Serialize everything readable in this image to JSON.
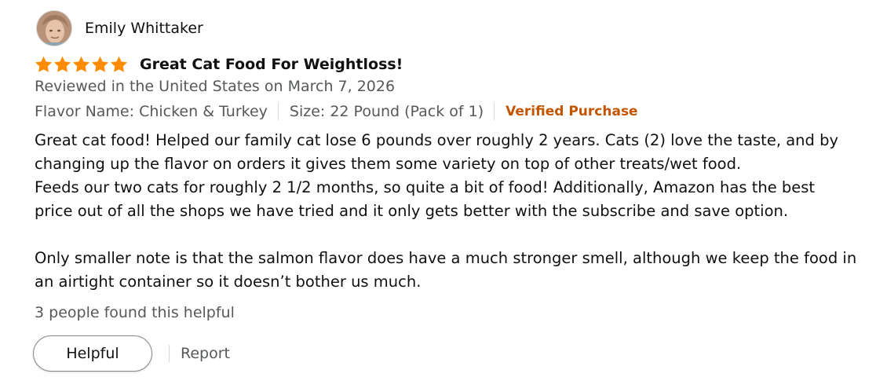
{
  "reviewer": {
    "name": "Emily Whittaker",
    "avatar_icon": "profile-photo"
  },
  "rating": {
    "stars": 5,
    "max": 5,
    "star_color": "#ff8c00"
  },
  "review": {
    "title": "Great Cat Food For Weightloss!",
    "reviewed_line": "Reviewed in the United States on March 7, 2026",
    "flavor": "Flavor Name: Chicken & Turkey",
    "size": "Size: 22 Pound (Pack of 1)",
    "verified": "Verified Purchase",
    "verified_color": "#c45500",
    "body_lines": [
      "Great cat food! Helped our family cat lose 6 pounds over roughly 2 years. Cats (2) love the taste, and by",
      "changing up the flavor on orders it gives them some variety on top of other treats/wet food.",
      "Feeds our two cats for roughly 2 1/2 months, so quite a bit of food! Additionally, Amazon has the best",
      "price out of all the shops we have tried and it only gets better with the subscribe and save option.",
      "Only smaller note is that the salmon flavor does have a much stronger smell, although we keep the food in",
      "an airtight container so it doesn’t bother us much."
    ]
  },
  "helpful_count_text": "3 people found this helpful",
  "actions": {
    "helpful_label": "Helpful",
    "report_label": "Report"
  }
}
